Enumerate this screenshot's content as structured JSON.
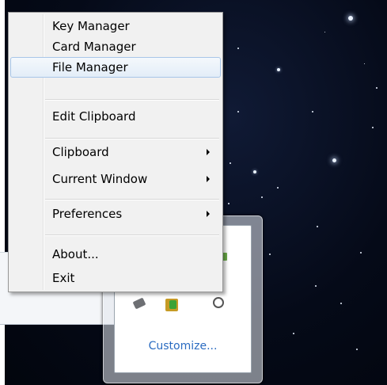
{
  "menu": {
    "items": [
      {
        "label": "Key Manager"
      },
      {
        "label": "Card Manager"
      },
      {
        "label": "File Manager"
      },
      {
        "label": "Edit Clipboard"
      },
      {
        "label": "Clipboard"
      },
      {
        "label": "Current Window"
      },
      {
        "label": "Preferences"
      },
      {
        "label": "About..."
      },
      {
        "label": "Exit"
      }
    ]
  },
  "tray": {
    "customize_label": "Customize..."
  },
  "colors": {
    "menu_background": "#f1f1f1",
    "hover_highlight": "#e3edf8",
    "link_blue": "#2a6bc1",
    "desktop": "#050a18"
  }
}
